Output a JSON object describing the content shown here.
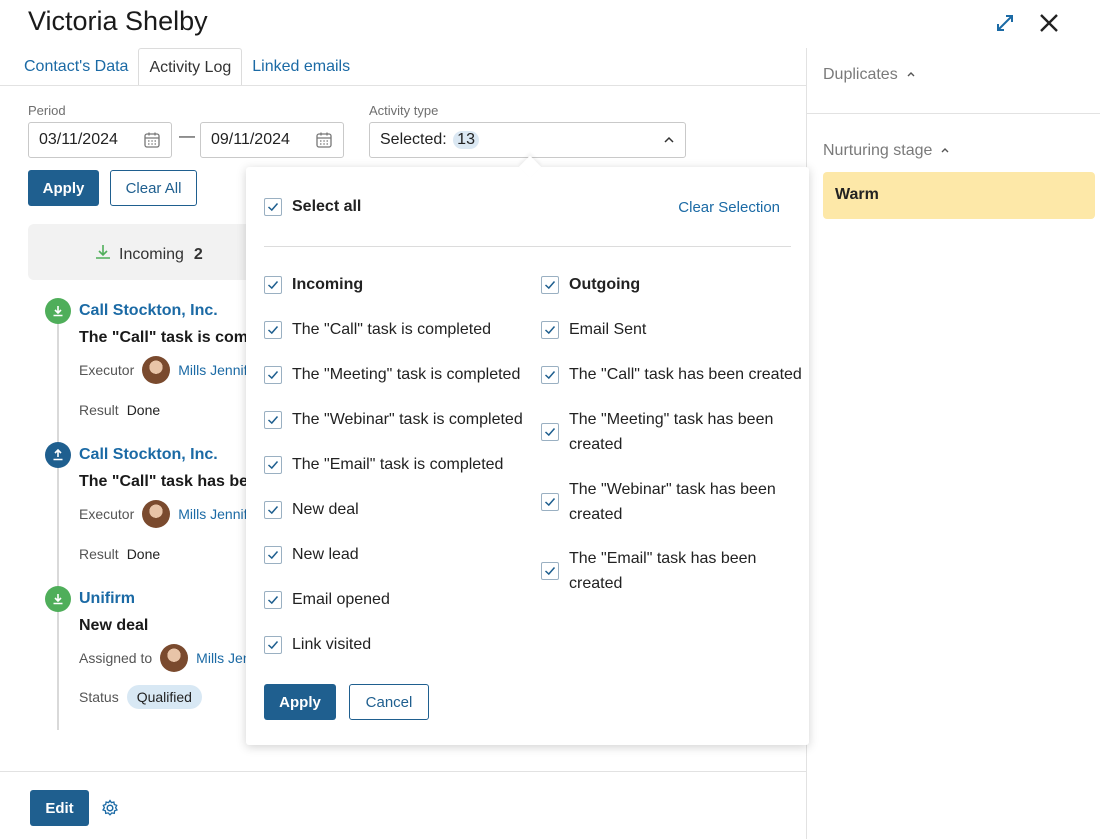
{
  "header": {
    "title": "Victoria Shelby",
    "expand_icon": "expand-icon",
    "close_icon": "close-icon"
  },
  "tabs": [
    {
      "label": "Contact's Data",
      "active": false
    },
    {
      "label": "Activity Log",
      "active": true
    },
    {
      "label": "Linked emails",
      "active": false
    }
  ],
  "filters": {
    "period_label": "Period",
    "date_from": "03/11/2024",
    "date_separator": "—",
    "date_to": "09/11/2024",
    "activity_type_label": "Activity type",
    "selected_prefix": "Selected:",
    "selected_count": "13",
    "apply_label": "Apply",
    "clear_all_label": "Clear All"
  },
  "summary": {
    "incoming_label": "Incoming",
    "incoming_count": "2"
  },
  "timeline": [
    {
      "direction": "in",
      "title": "Call Stockton, Inc.",
      "subtitle": "The \"Call\" task is completed",
      "person_label": "Executor",
      "person": "Mills Jennifer",
      "extra_label": "Result",
      "extra_value": "Done"
    },
    {
      "direction": "out",
      "title": "Call Stockton, Inc.",
      "subtitle": "The \"Call\" task has been created",
      "person_label": "Executor",
      "person": "Mills Jennifer",
      "extra_label": "Result",
      "extra_value": "Done"
    },
    {
      "direction": "in",
      "title": "Unifirm",
      "subtitle": "New deal",
      "person_label": "Assigned to",
      "person": "Mills Jennifer",
      "extra_label": "Status",
      "extra_value": "Qualified"
    }
  ],
  "footer": {
    "edit_label": "Edit",
    "settings_icon": "gear-icon"
  },
  "sidebar": {
    "duplicates_label": "Duplicates",
    "nurturing_label": "Nurturing stage",
    "stage_value": "Warm",
    "stage_color": "#fde8a8"
  },
  "dropdown": {
    "select_all_label": "Select all",
    "clear_selection_label": "Clear Selection",
    "incoming_group": "Incoming",
    "outgoing_group": "Outgoing",
    "incoming_items": [
      "The \"Call\" task is completed",
      "The \"Meeting\" task is completed",
      "The \"Webinar\" task is completed",
      "The \"Email\" task is completed",
      "New deal",
      "New lead",
      "Email opened",
      "Link visited"
    ],
    "outgoing_items": [
      "Email Sent",
      "The \"Call\" task has been created",
      "The \"Meeting\" task has been created",
      "The \"Webinar\" task has been created",
      "The \"Email\" task has been created"
    ],
    "apply_label": "Apply",
    "cancel_label": "Cancel"
  },
  "colors": {
    "accent": "#1f5f8f",
    "link": "#1b6aa5",
    "incoming_green": "#4fae5a"
  }
}
